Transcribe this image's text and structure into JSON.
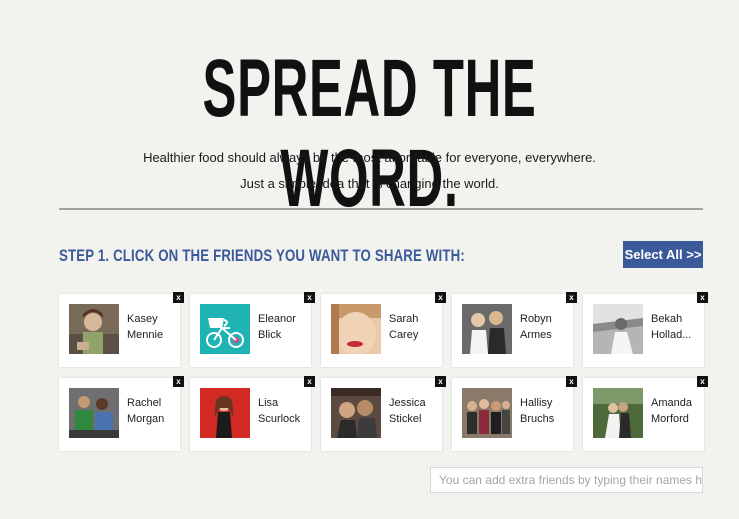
{
  "header": {
    "title": "SPREAD THE WORD.",
    "subtitle_line1": "Healthier food should always be the most affordable for everyone, everywhere.",
    "subtitle_line2": "Just a simple idea that is changing the world."
  },
  "step": {
    "heading": "STEP 1. CLICK ON THE FRIENDS YOU WANT TO SHARE WITH:",
    "select_all_label": "Select All >>"
  },
  "friends": [
    {
      "first": "Kasey",
      "last": "Mennie"
    },
    {
      "first": "Eleanor",
      "last": "Blick"
    },
    {
      "first": "Sarah",
      "last": "Carey"
    },
    {
      "first": "Robyn",
      "last": "Armes"
    },
    {
      "first": "Bekah",
      "last": "Hollad..."
    },
    {
      "first": "Rachel",
      "last": "Morgan"
    },
    {
      "first": "Lisa",
      "last": "Scurlock"
    },
    {
      "first": "Jessica",
      "last": "Stickel"
    },
    {
      "first": "Hallisy",
      "last": "Bruchs"
    },
    {
      "first": "Amanda",
      "last": "Morford"
    }
  ],
  "close_glyph": "x",
  "extra": {
    "placeholder": "You can add extra friends by typing their names here"
  },
  "colors": {
    "accent": "#3b5a9a",
    "background": "#f2f2ef"
  }
}
